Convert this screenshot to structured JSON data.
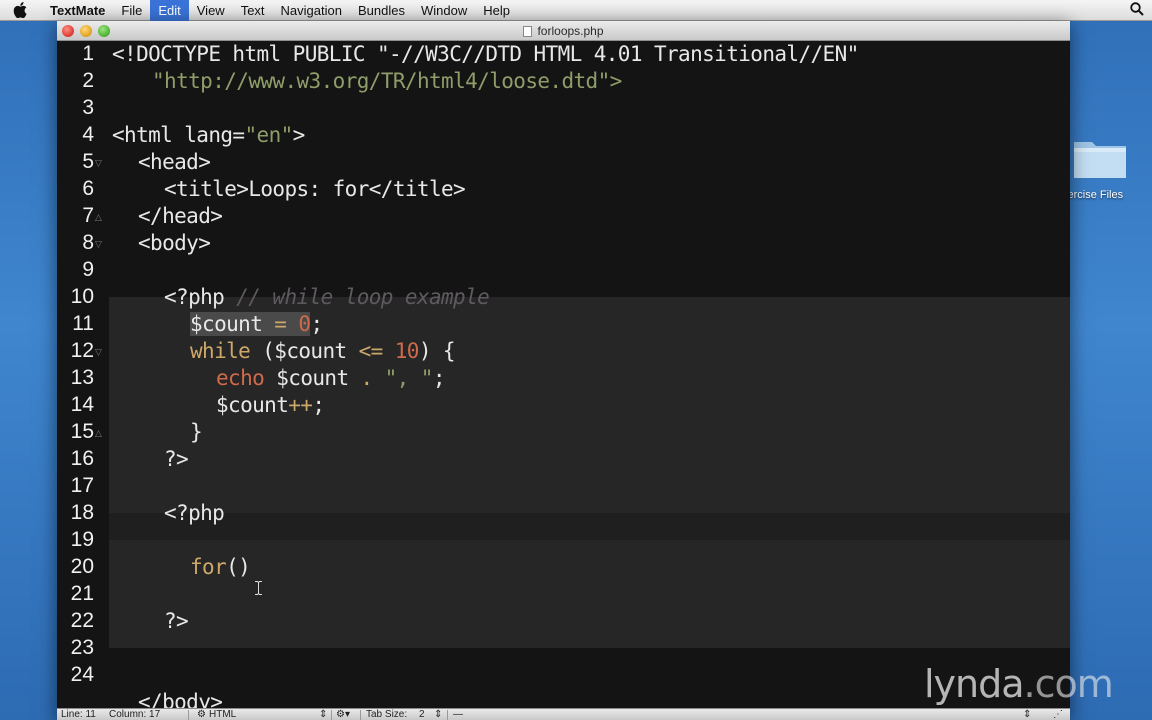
{
  "menubar": {
    "app_name": "TextMate",
    "items": [
      "File",
      "Edit",
      "View",
      "Text",
      "Navigation",
      "Bundles",
      "Window",
      "Help"
    ],
    "active_item": "Edit"
  },
  "window": {
    "title": "forloops.php"
  },
  "editor": {
    "lines": [
      {
        "num": "1"
      },
      {
        "num": "2"
      },
      {
        "num": "3"
      },
      {
        "num": "4"
      },
      {
        "num": "5"
      },
      {
        "num": "6"
      },
      {
        "num": "7"
      },
      {
        "num": "8"
      },
      {
        "num": "9"
      },
      {
        "num": "10"
      },
      {
        "num": "11"
      },
      {
        "num": "12"
      },
      {
        "num": "13"
      },
      {
        "num": "14"
      },
      {
        "num": "15"
      },
      {
        "num": "16"
      },
      {
        "num": "17"
      },
      {
        "num": "18"
      },
      {
        "num": "19"
      },
      {
        "num": "20"
      },
      {
        "num": "21"
      },
      {
        "num": "22"
      },
      {
        "num": "23"
      },
      {
        "num": "24"
      }
    ],
    "code": {
      "l1": "<!DOCTYPE html PUBLIC \"-//W3C//DTD HTML 4.01 Transitional//EN\"",
      "l2": "\"http://www.w3.org/TR/html4/loose.dtd\">",
      "l4_open": "<html lang=",
      "l4_attr": "\"en\"",
      "l4_close": ">",
      "l5": "<head>",
      "l6_open": "<title>",
      "l6_text": "Loops: for",
      "l6_close": "</title>",
      "l7": "</head>",
      "l8": "<body>",
      "l10_php": "<?php",
      "l10_cmt": "// while loop example",
      "l11_var": "$count",
      "l11_op": " = ",
      "l11_num": "0",
      "l11_end": ";",
      "l12_kw": "while",
      "l12_a": " ($count ",
      "l12_op": "<=",
      "l12_num": " 10",
      "l12_b": ") {",
      "l13_echo": "echo",
      "l13_a": " $count ",
      "l13_op": ".",
      "l13_str": " \", \"",
      "l13_end": ";",
      "l14_var": "$count",
      "l14_op": "++",
      "l14_end": ";",
      "l15": "}",
      "l16": "?>",
      "l18": "<?php",
      "l20_kw": "for",
      "l20_rest": "()",
      "l22": "?>",
      "l25": "</body>"
    }
  },
  "statusbar": {
    "line": "Line: 11",
    "column": "Column: 17",
    "language": "HTML",
    "tab_size_label": "Tab Size:",
    "tab_size": "2"
  },
  "desktop": {
    "folder_label": "xercise Files"
  },
  "watermark": {
    "text": "lynda",
    "suffix": ".com"
  },
  "colors": {
    "editor_bg": "#141414",
    "embedded_bg": "#262626",
    "keyword": "#cda869",
    "string": "#8f9d6a",
    "comment": "#5f5a60",
    "number": "#cf6a4c",
    "menu_active": "#3a74d8"
  }
}
